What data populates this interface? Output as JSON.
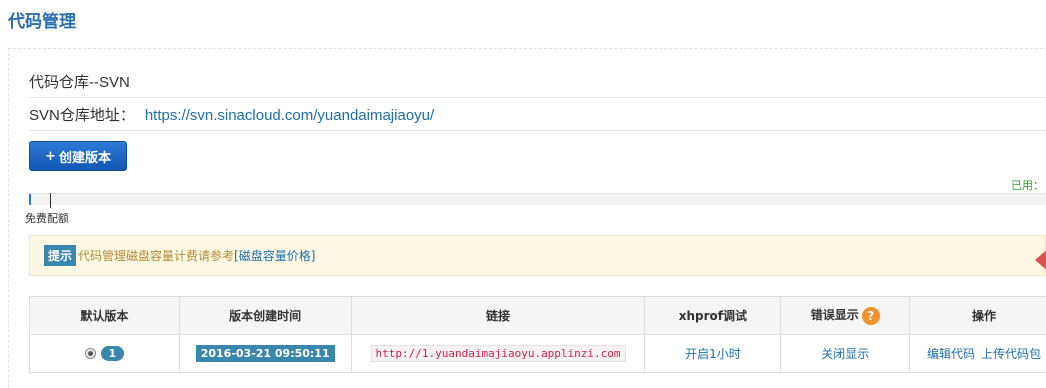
{
  "page": {
    "title": "代码管理"
  },
  "repo": {
    "title": "代码仓库--SVN",
    "address_label": "SVN仓库地址：",
    "address_url": "https://svn.sinacloud.com/yuandaimajiaoyu/"
  },
  "actions": {
    "create_version": "创建版本",
    "plus_icon": "+"
  },
  "quota": {
    "used_label": "已用：",
    "free_label": "免费配额",
    "used_fraction": 0.002
  },
  "tip": {
    "badge": "提示",
    "text": "代码管理磁盘容量计费请参考",
    "link_text": "[磁盘容量价格]"
  },
  "table": {
    "headers": [
      "默认版本",
      "版本创建时间",
      "链接",
      "xhprof调试",
      "错误显示",
      "操作"
    ],
    "help_icon": "?",
    "rows": [
      {
        "version": "1",
        "created": "2016-03-21 09:50:11",
        "link": "http://1.yuandaimajiaoyu.applinzi.com",
        "xhprof": "开启1小时",
        "errors": "关闭显示",
        "op_edit": "编辑代码",
        "op_upload": "上传代码包"
      }
    ]
  },
  "colors": {
    "accent": "#2a6fb0",
    "badge": "#3a87ad",
    "button": "#1a66c4",
    "warning_bg": "#fcf8e3",
    "help": "#f0932b",
    "arrow": "#d9534f"
  }
}
